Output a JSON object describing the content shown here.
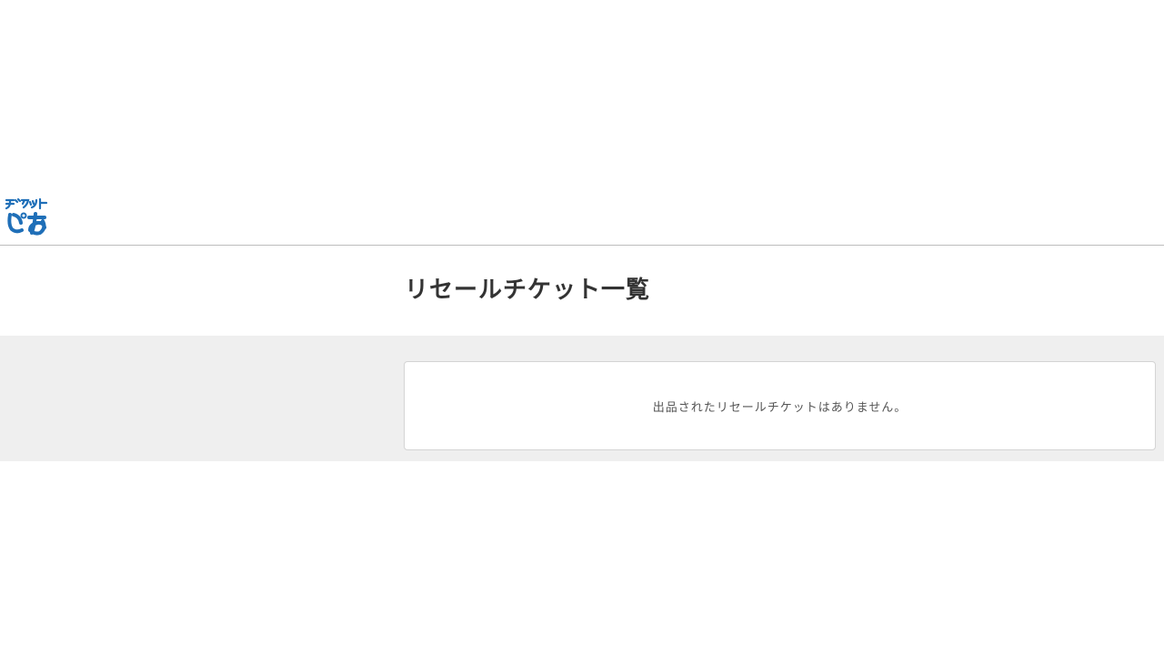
{
  "header": {
    "logo": {
      "top_text": "デジタルチケット",
      "bottom_text": "ぴあ",
      "brand_color": "#1f6fb8",
      "icon": "tpia-logo"
    }
  },
  "main": {
    "title": "リセールチケット一覧",
    "empty_message": "出品されたリセールチケットはありません。"
  },
  "colors": {
    "content_background": "#efefef",
    "card_background": "#ffffff",
    "divider": "#bdbdbd"
  }
}
